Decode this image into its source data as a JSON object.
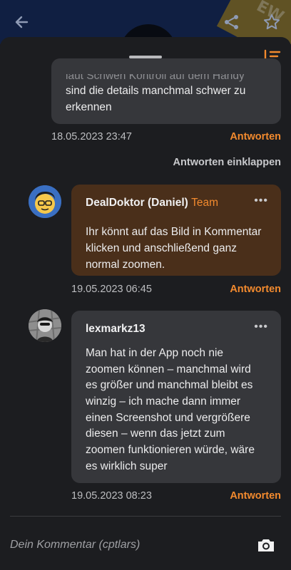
{
  "colors": {
    "accent": "#f28a2e",
    "background": "#1c1d20",
    "bubble": "#36373b",
    "team_bubble": "#4a2f1a"
  },
  "topbar": {
    "back_icon": "arrow-left-icon",
    "share_icon": "share-icon",
    "star_icon": "star-icon",
    "banner_text": "EW"
  },
  "sheet": {
    "sort_icon": "sort-descending-icon"
  },
  "comments": [
    {
      "partial_line": "laut Scriwen Kontroll auf dem Handy",
      "text_lines": [
        "sind die details manchmal schwer zu",
        "erkennen"
      ],
      "date": "18.05.2023 23:47",
      "reply_label": "Antworten"
    },
    {
      "collapse_label": "Antworten einklappen"
    },
    {
      "author": "DealDoktor (Daniel)",
      "tag": "Team",
      "more": "•••",
      "text_lines": [
        "Ihr könnt auf das Bild in Kommentar",
        "klicken und anschließend ganz",
        "normal zoomen."
      ],
      "date": "19.05.2023 06:45",
      "reply_label": "Antworten"
    },
    {
      "author": "lexmarkz13",
      "more": "•••",
      "text_lines": [
        "Man hat in der App noch nie",
        "zoomen können – manchmal wird",
        "es größer und manchmal bleibt es",
        "winzig – ich mache dann immer",
        "einen Screenshot und vergrößere",
        "diesen – wenn das jetzt zum",
        "zoomen funktionieren würde, wäre",
        "es wirklich super"
      ],
      "date": "19.05.2023 08:23",
      "reply_label": "Antworten"
    }
  ],
  "input": {
    "placeholder": "Dein Kommentar (cptlars)",
    "camera_icon": "camera-icon"
  }
}
